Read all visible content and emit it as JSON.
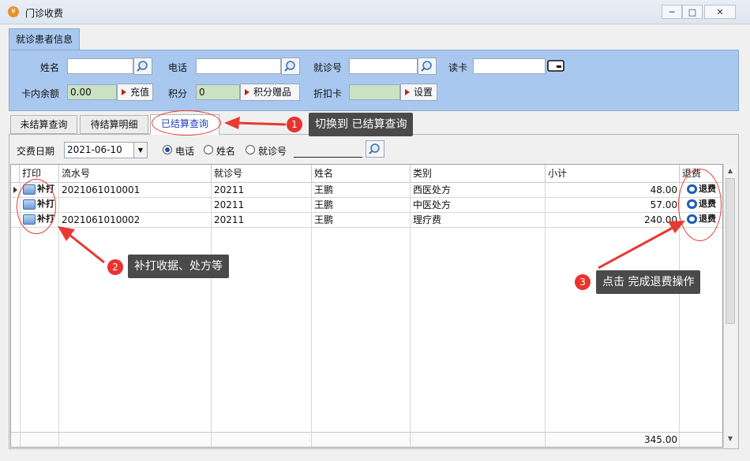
{
  "window": {
    "title": "门诊收费",
    "minimize": "─",
    "restore": "□",
    "close": "✕"
  },
  "patient_group": {
    "tab_label": "就诊患者信息",
    "name_label": "姓名",
    "phone_label": "电话",
    "visit_no_label": "就诊号",
    "read_card_label": "读卡",
    "balance_label": "卡内余额",
    "balance_value": "0.00",
    "recharge_button": "充值",
    "points_label": "积分",
    "points_value": "0",
    "points_gift_button": "积分赠品",
    "discount_card_label": "折扣卡",
    "settings_button": "设置"
  },
  "tabs": [
    "未结算查询",
    "待结算明细",
    "已结算查询"
  ],
  "filter": {
    "date_label": "交费日期",
    "date_value": "2021-06-10",
    "radio_phone": "电话",
    "radio_name": "姓名",
    "radio_visit": "就诊号",
    "selected": "电话"
  },
  "grid": {
    "columns": [
      "打印",
      "流水号",
      "就诊号",
      "姓名",
      "类别",
      "小计",
      "退费"
    ],
    "rows": [
      {
        "print": "补打",
        "serial": "2021061010001",
        "visit_no": "20211",
        "name": "王鹏",
        "category": "西医处方",
        "subtotal": "48.00",
        "refund": "退费"
      },
      {
        "print": "补打",
        "serial": "",
        "visit_no": "20211",
        "name": "王鹏",
        "category": "中医处方",
        "subtotal": "57.00",
        "refund": "退费"
      },
      {
        "print": "补打",
        "serial": "2021061010002",
        "visit_no": "20211",
        "name": "王鹏",
        "category": "理疗费",
        "subtotal": "240.00",
        "refund": "退费"
      }
    ],
    "total": "345.00"
  },
  "annotations": {
    "step1_number": "1",
    "step1_text": "切换到 已结算查询",
    "step2_number": "2",
    "step2_text": "补打收据、处方等",
    "step3_number": "3",
    "step3_text": "点击 完成退费操作"
  },
  "colors": {
    "panel_blue": "#a9c8ef",
    "input_green": "#c9e2c2",
    "annotation_red": "#e8332e",
    "callout_bg": "#4a4a4a"
  }
}
